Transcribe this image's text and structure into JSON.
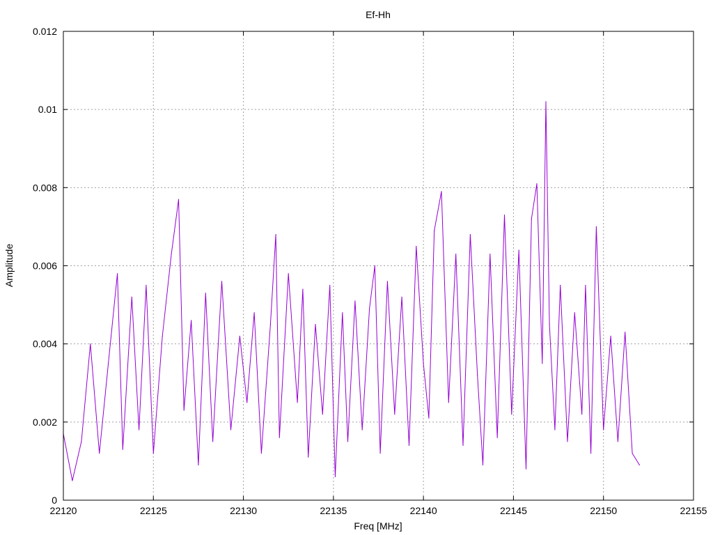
{
  "chart_data": {
    "type": "line",
    "title": "Ef-Hh",
    "xlabel": "Freq [MHz]",
    "ylabel": "Amplitude",
    "xlim": [
      22120,
      22155
    ],
    "ylim": [
      0,
      0.012
    ],
    "x_ticks": [
      22120,
      22125,
      22130,
      22135,
      22140,
      22145,
      22150,
      22155
    ],
    "x_tick_labels": [
      "22120",
      "22125",
      "22130",
      "22135",
      "22140",
      "22145",
      "22150",
      "22155"
    ],
    "y_ticks": [
      0,
      0.002,
      0.004,
      0.006,
      0.008,
      0.01,
      0.012
    ],
    "y_tick_labels": [
      "0",
      "0.002",
      "0.004",
      "0.006",
      "0.008",
      "0.01",
      "0.012"
    ],
    "grid": true,
    "grid_style": "dotted",
    "series": [
      {
        "color": "#9400d3",
        "x": [
          22120.0,
          22120.5,
          22121.0,
          22121.5,
          22122.0,
          22122.5,
          22123.0,
          22123.3,
          22123.8,
          22124.2,
          22124.6,
          22125.0,
          22125.5,
          22126.0,
          22126.4,
          22126.7,
          22127.1,
          22127.5,
          22127.9,
          22128.3,
          22128.8,
          22129.3,
          22129.8,
          22130.2,
          22130.6,
          22131.0,
          22131.5,
          22131.8,
          22132.0,
          22132.5,
          22133.0,
          22133.3,
          22133.6,
          22134.0,
          22134.4,
          22134.8,
          22135.1,
          22135.5,
          22135.8,
          22136.2,
          22136.6,
          22137.0,
          22137.3,
          22137.6,
          22138.0,
          22138.4,
          22138.8,
          22139.2,
          22139.6,
          22140.0,
          22140.3,
          22140.6,
          22141.0,
          22141.4,
          22141.8,
          22142.2,
          22142.6,
          22143.0,
          22143.3,
          22143.7,
          22144.1,
          22144.5,
          22144.9,
          22145.3,
          22145.7,
          22146.0,
          22146.3,
          22146.6,
          22146.8,
          22147.0,
          22147.3,
          22147.6,
          22148.0,
          22148.4,
          22148.8,
          22149.0,
          22149.3,
          22149.6,
          22150.0,
          22150.4,
          22150.8,
          22151.2,
          22151.6,
          22152.0
        ],
        "y": [
          0.0017,
          0.0005,
          0.0015,
          0.004,
          0.0012,
          0.0035,
          0.0058,
          0.0013,
          0.0052,
          0.0018,
          0.0055,
          0.0012,
          0.0042,
          0.0063,
          0.0077,
          0.0023,
          0.0046,
          0.0009,
          0.0053,
          0.0015,
          0.0056,
          0.0018,
          0.0042,
          0.0025,
          0.0048,
          0.0012,
          0.0045,
          0.0068,
          0.0016,
          0.0058,
          0.0025,
          0.0054,
          0.0011,
          0.0045,
          0.0022,
          0.0055,
          0.0006,
          0.0048,
          0.0015,
          0.0051,
          0.0018,
          0.0049,
          0.006,
          0.0012,
          0.0056,
          0.0022,
          0.0052,
          0.0014,
          0.0065,
          0.0035,
          0.0021,
          0.0069,
          0.0079,
          0.0025,
          0.0063,
          0.0014,
          0.0068,
          0.0032,
          0.0009,
          0.0063,
          0.0016,
          0.0073,
          0.0022,
          0.0064,
          0.0008,
          0.0072,
          0.0081,
          0.0035,
          0.0102,
          0.0045,
          0.0018,
          0.0055,
          0.0015,
          0.0048,
          0.0022,
          0.0055,
          0.0012,
          0.007,
          0.0018,
          0.0042,
          0.0015,
          0.0043,
          0.0012,
          0.0009
        ]
      }
    ]
  }
}
